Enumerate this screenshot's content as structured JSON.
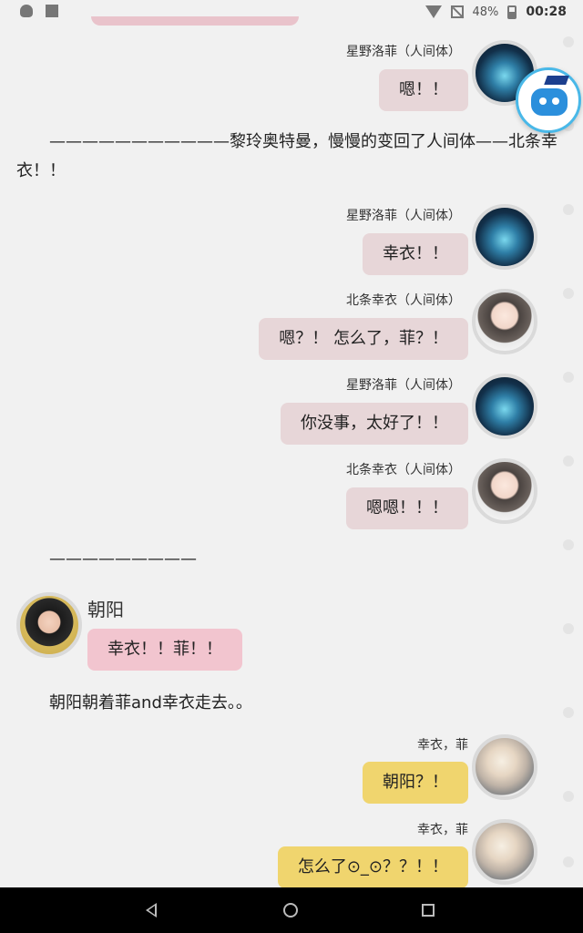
{
  "status_bar": {
    "battery": "48%",
    "time": "00:28"
  },
  "messages": [
    {
      "speaker": "星野洛菲（人间体）",
      "text": "嗯！！"
    },
    {
      "speaker": "星野洛菲（人间体）",
      "text": "幸衣！！"
    },
    {
      "speaker": "北条幸衣（人间体）",
      "text": "嗯？！ 怎么了，菲？！"
    },
    {
      "speaker": "星野洛菲（人间体）",
      "text": "你没事，太好了！！"
    },
    {
      "speaker": "北条幸衣（人间体）",
      "text": "嗯嗯！！！"
    },
    {
      "speaker": "朝阳",
      "text": "幸衣！！菲！！"
    },
    {
      "speaker": "幸衣，菲",
      "text": "朝阳？！"
    },
    {
      "speaker": "幸衣，菲",
      "text": "怎么了⊙_⊙？？！！"
    }
  ],
  "narration": {
    "line1": "———————————黎玲奥特曼，慢慢的变回了人间体——北条幸",
    "line1b": "衣！！",
    "line2": "—————————",
    "line3": "朝阳朝着菲and幸衣走去。。"
  },
  "colors": {
    "pink_bubble": "#e7d6d8",
    "hot_bubble": "#f2c5cf",
    "yellow_bubble": "#f0d56e"
  }
}
